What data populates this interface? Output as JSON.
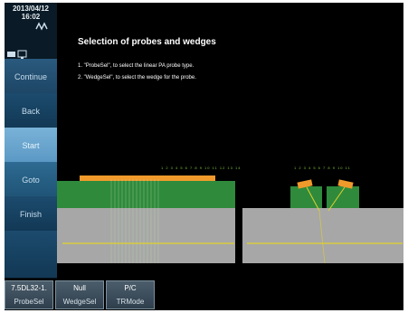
{
  "clock": {
    "date": "2013/04/12",
    "time": "16:02"
  },
  "sidebar": {
    "buttons": [
      {
        "label": "Continue",
        "name": "continue-button"
      },
      {
        "label": "Back",
        "name": "back-button"
      },
      {
        "label": "Start",
        "name": "start-button"
      },
      {
        "label": "Goto",
        "name": "goto-button"
      },
      {
        "label": "Finish",
        "name": "finish-button"
      }
    ]
  },
  "main": {
    "title": "Selection of probes and wedges",
    "steps": [
      "1. \"ProbeSel\", to select the linear PA probe type.",
      "2. \"WedgeSel\", to select the wedge for the probe."
    ],
    "left_scale": "1 2 3 4 5 6 7 8 9 10 11 12 13 14",
    "right_scale": "1 2 3 4 5 6 7 8 9 10 11"
  },
  "bottombar": {
    "items": [
      {
        "value": "7.5DL32-1.",
        "label": "ProbeSel"
      },
      {
        "value": "Null",
        "label": "WedgeSel"
      },
      {
        "value": "P/C",
        "label": "TRMode"
      }
    ]
  },
  "colors": {
    "sidebar_bg": "#0a1a26",
    "button_blue": "#1f5476",
    "button_selected": "#6aa6d0",
    "probe_green": "#2f8a3c",
    "specimen_grey": "#a7a7a7",
    "probe_orange": "#f19a2c",
    "weld_line": "#e2d12a"
  }
}
